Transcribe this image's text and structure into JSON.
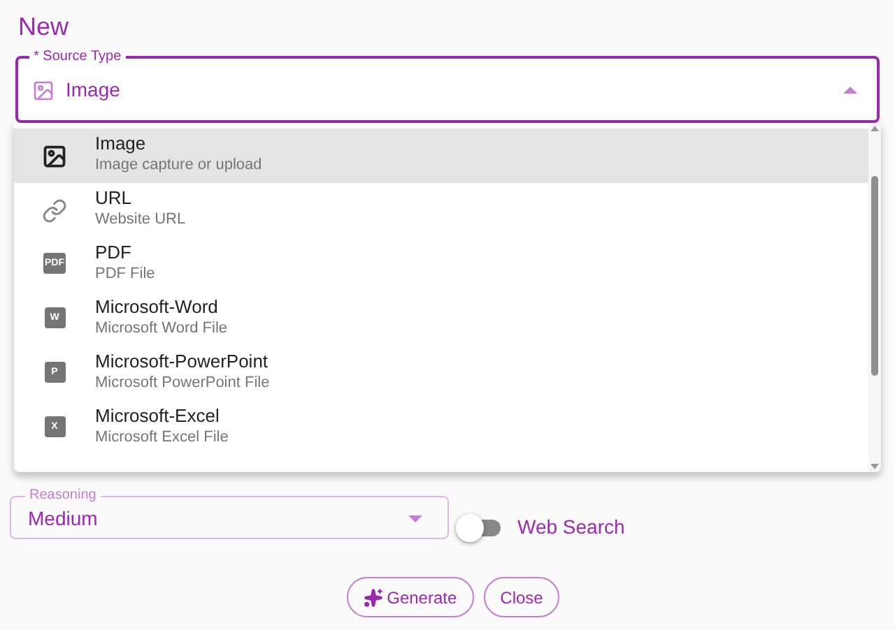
{
  "title": "New",
  "source_type": {
    "label": "* Source Type",
    "value": "Image",
    "expanded": true
  },
  "options": [
    {
      "kind": "image",
      "label": "Image",
      "description": "Image capture or upload",
      "selected": true
    },
    {
      "kind": "link",
      "label": "URL",
      "description": "Website URL",
      "selected": false
    },
    {
      "kind": "badge",
      "badge": "PDF",
      "label": "PDF",
      "description": "PDF File",
      "selected": false
    },
    {
      "kind": "badge",
      "badge": "W",
      "label": "Microsoft-Word",
      "description": "Microsoft Word File",
      "selected": false
    },
    {
      "kind": "badge",
      "badge": "P",
      "label": "Microsoft-PowerPoint",
      "description": "Microsoft PowerPoint File",
      "selected": false
    },
    {
      "kind": "badge",
      "badge": "X",
      "label": "Microsoft-Excel",
      "description": "Microsoft Excel File",
      "selected": false
    }
  ],
  "reasoning": {
    "label": "Reasoning",
    "value": "Medium"
  },
  "web_search": {
    "label": "Web Search",
    "on": false
  },
  "buttons": [
    {
      "kind": "generate",
      "label": "Generate"
    },
    {
      "kind": "plain",
      "label": "Close"
    }
  ]
}
